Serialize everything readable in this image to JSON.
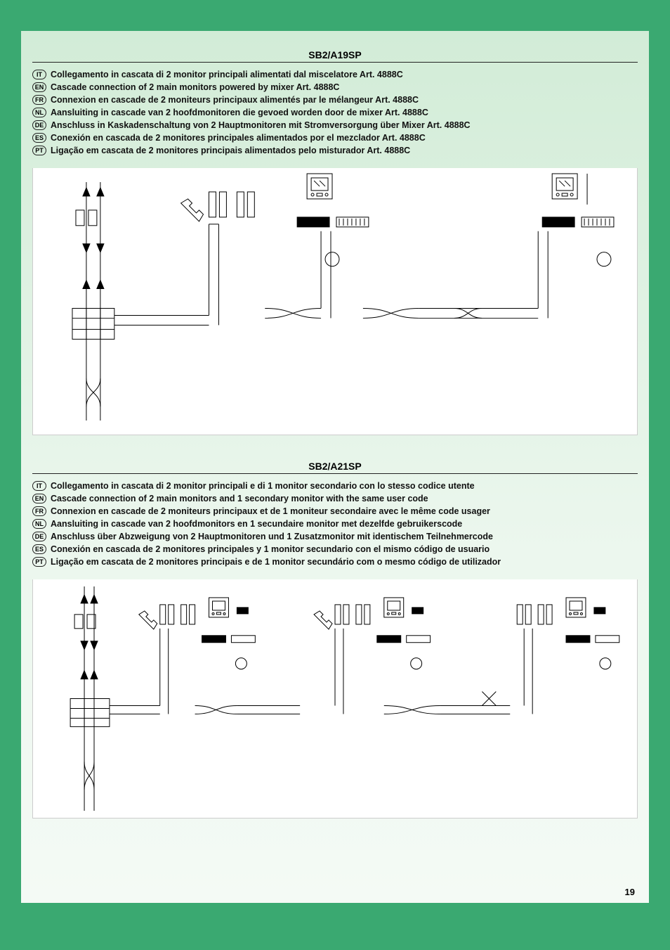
{
  "page_number": "19",
  "section1": {
    "code": "SB2/A19SP",
    "langs": {
      "IT": "Collegamento in cascata di 2 monitor principali alimentati dal miscelatore Art. 4888C",
      "EN": "Cascade connection of 2 main monitors powered by mixer Art. 4888C",
      "FR": "Connexion en cascade de 2 moniteurs principaux alimentés par le mélangeur Art. 4888C",
      "NL": "Aansluiting in cascade van 2 hoofdmonitoren die gevoed worden door de mixer Art. 4888C",
      "DE": "Anschluss in Kaskadenschaltung von 2 Hauptmonitoren mit Stromversorgung über Mixer Art. 4888C",
      "ES": "Conexión en cascada de 2 monitores principales alimentados por el mezclador Art. 4888C",
      "PT": "Ligação em cascata de 2 monitores principais alimentados pelo misturador Art. 4888C"
    }
  },
  "section2": {
    "code": "SB2/A21SP",
    "langs": {
      "IT": "Collegamento in cascata di 2 monitor principali e di 1 monitor secondario con lo stesso codice utente",
      "EN": "Cascade connection of 2 main monitors and 1 secondary monitor with the same user code",
      "FR": "Connexion en cascade de 2 moniteurs principaux et de 1 moniteur secondaire avec le même code usager",
      "NL": "Aansluiting in cascade van 2 hoofdmonitors en 1 secundaire monitor met dezelfde gebruikerscode",
      "DE": "Anschluss über Abzweigung von 2 Hauptmonitoren und 1 Zusatzmonitor mit identischem Teilnehmercode",
      "ES": "Conexión en cascada de 2 monitores principales y 1 monitor secundario con el mismo código de usuario",
      "PT": "Ligação em cascata de 2 monitores principais e de 1 monitor secundário com o mesmo código de utilizador"
    }
  }
}
